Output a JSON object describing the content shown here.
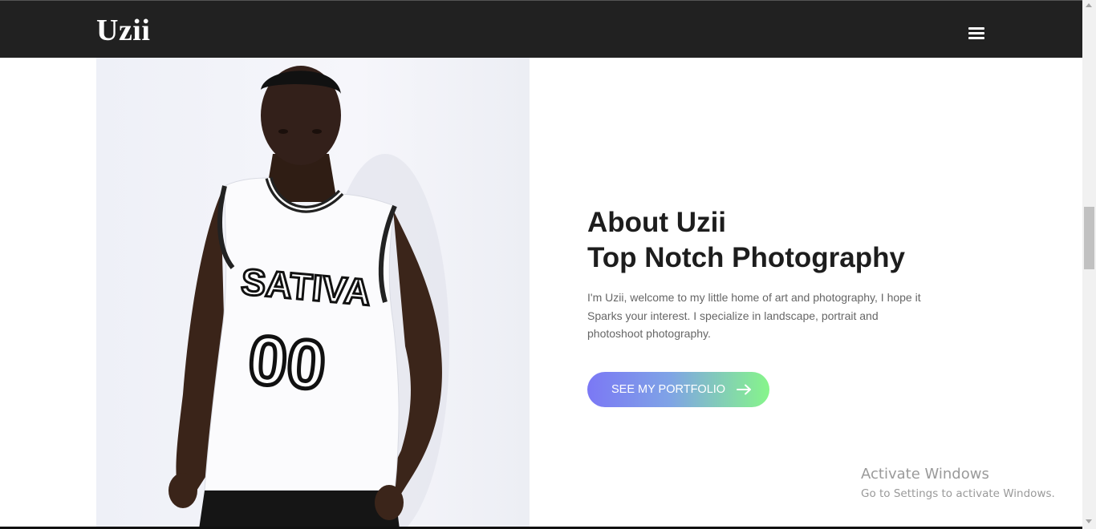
{
  "nav": {
    "brand": "Uzii",
    "menu_icon": "hamburger-menu-icon"
  },
  "hero": {
    "photo_alt": "Photo of Uzii in a white SATIVA 00 jersey",
    "jersey_text": "SATIVA",
    "jersey_number": "00",
    "heading_line1": "About Uzii",
    "heading_line2": "Top Notch Photography",
    "intro": "I'm Uzii, welcome to my little home of art and photography, I hope it Sparks your interest. I specialize in landscape, portrait and photoshoot photography.",
    "cta_label": "SEE MY PORTFOLIO",
    "cta_icon": "arrow-right-icon"
  },
  "watermark": {
    "line1": "Activate Windows",
    "line2": "Go to Settings to activate Windows."
  },
  "colors": {
    "navbar_bg": "#212121",
    "cta_start": "#7b78f5",
    "cta_end": "#86f58a",
    "heading": "#1d1d1d"
  }
}
